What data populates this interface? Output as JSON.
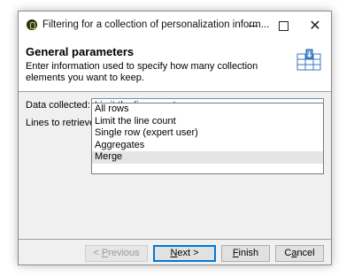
{
  "window": {
    "title": "Filtering for a collection of personalization inform..."
  },
  "header": {
    "title": "General parameters",
    "description": "Enter information used to specify how many collection elements you want to keep."
  },
  "form": {
    "data_collected_label": "Data collected:",
    "data_collected_value": "Limit the line count",
    "lines_label": "Lines to retrieve:",
    "options": [
      "All rows",
      "Limit the line count",
      "Single row (expert user)",
      "Aggregates",
      "Merge"
    ],
    "hovered_option": "Merge"
  },
  "buttons": {
    "previous": {
      "pre": "< ",
      "mnemonic": "P",
      "post": "revious"
    },
    "next": {
      "mnemonic": "N",
      "post": "ext >"
    },
    "finish": {
      "mnemonic": "F",
      "post": "inish"
    },
    "cancel": {
      "pre": "C",
      "mnemonic": "a",
      "post": "ncel"
    }
  }
}
